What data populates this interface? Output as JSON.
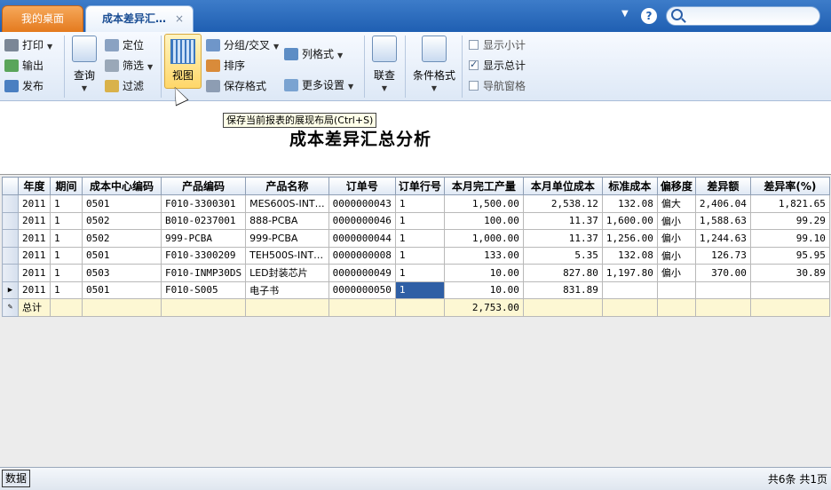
{
  "tabs": {
    "home": "我的桌面",
    "active": "成本差异汇…",
    "close": "×"
  },
  "toolbar": {
    "print": "打印",
    "export": "输出",
    "publish": "发布",
    "query": "查询",
    "locate": "定位",
    "filter": "筛选",
    "filter2": "过滤",
    "view": "视图",
    "group": "分组/交叉",
    "sort": "排序",
    "save_format": "保存格式",
    "col_format": "列格式",
    "more_settings": "更多设置",
    "link_query": "联查",
    "cond_format": "条件格式",
    "show_subtotal": "显示小计",
    "show_total": "显示总计",
    "nav_pane": "导航窗格",
    "show_subtotal_checked": false,
    "show_total_checked": true,
    "nav_pane_checked": false
  },
  "tooltip": "保存当前报表的展现布局(Ctrl+S)",
  "report": {
    "title": "成本差异汇总分析"
  },
  "grid": {
    "columns": [
      "年度",
      "期间",
      "成本中心编码",
      "产品编码",
      "产品名称",
      "订单号",
      "订单行号",
      "本月完工产量",
      "本月单位成本",
      "标准成本",
      "偏移度",
      "差异额",
      "差异率(%)"
    ],
    "rows": [
      [
        "2011",
        "1",
        "0501",
        "F010-3300301",
        "MES600S-INT…",
        "0000000043",
        "1",
        "1,500.00",
        "2,538.12",
        "132.08",
        "偏大",
        "2,406.04",
        "1,821.65"
      ],
      [
        "2011",
        "1",
        "0502",
        "B010-0237001",
        "888-PCBA",
        "0000000046",
        "1",
        "100.00",
        "11.37",
        "1,600.00",
        "偏小",
        "1,588.63",
        "99.29"
      ],
      [
        "2011",
        "1",
        "0502",
        "999-PCBA",
        "999-PCBA",
        "0000000044",
        "1",
        "1,000.00",
        "11.37",
        "1,256.00",
        "偏小",
        "1,244.63",
        "99.10"
      ],
      [
        "2011",
        "1",
        "0501",
        "F010-3300209",
        "TEH500S-INT…",
        "0000000008",
        "1",
        "133.00",
        "5.35",
        "132.08",
        "偏小",
        "126.73",
        "95.95"
      ],
      [
        "2011",
        "1",
        "0503",
        "F010-INMP30DS",
        "LED封装芯片",
        "0000000049",
        "1",
        "10.00",
        "827.80",
        "1,197.80",
        "偏小",
        "370.00",
        "30.89"
      ],
      [
        "2011",
        "1",
        "0501",
        "F010-S005",
        "电子书",
        "0000000050",
        "1",
        "10.00",
        "831.89",
        "",
        "",
        "",
        ""
      ]
    ],
    "total_label": "总计",
    "total_qty": "2,753.00"
  },
  "status": {
    "tab": "数据",
    "summary": "共6条 共1页"
  },
  "colors": {
    "tabbar": "#1f5fb2",
    "home_tab": "#e47a1e",
    "selected_cell": "#2f5fa5",
    "total_row": "#fdf7d3"
  }
}
